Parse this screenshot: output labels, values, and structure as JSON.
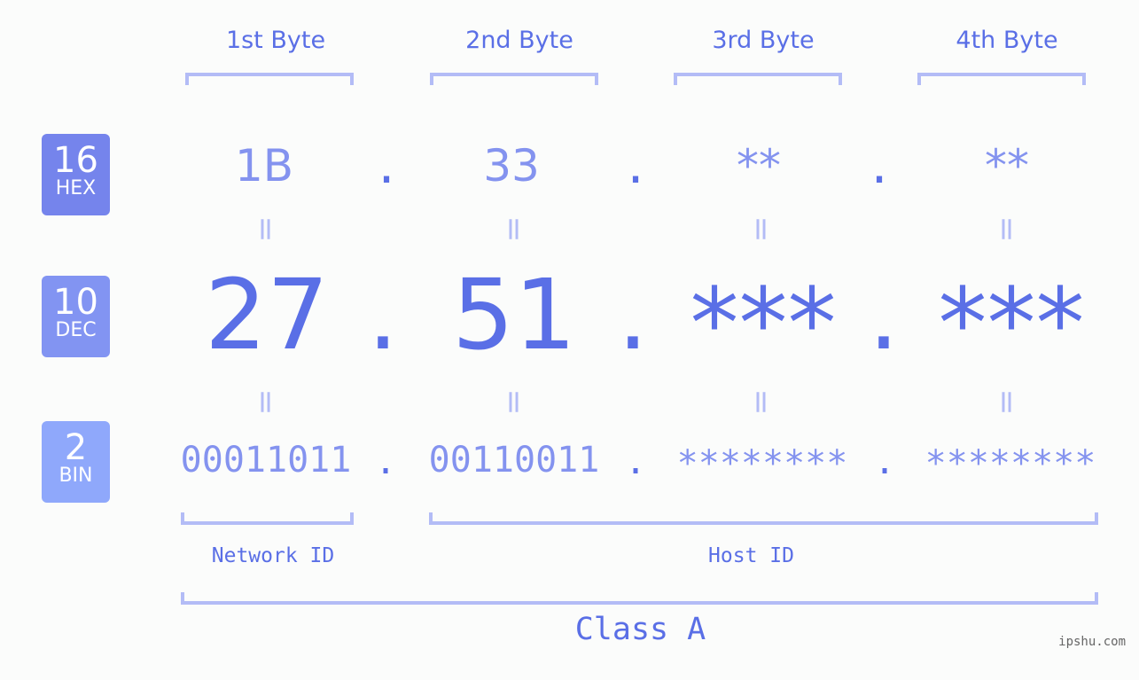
{
  "bytes": [
    {
      "title": "1st Byte",
      "hex": "1B",
      "dec": "27",
      "bin": "00011011"
    },
    {
      "title": "2nd Byte",
      "hex": "33",
      "dec": "51",
      "bin": "00110011"
    },
    {
      "title": "3rd Byte",
      "hex": "**",
      "dec": "***",
      "bin": "********"
    },
    {
      "title": "4th Byte",
      "hex": "**",
      "dec": "***",
      "bin": "********"
    }
  ],
  "separator": ".",
  "equals": "=",
  "badges": {
    "hex": {
      "num": "16",
      "label": "HEX",
      "color": "#7584ec"
    },
    "dec": {
      "num": "10",
      "label": "DEC",
      "color": "#8294f2"
    },
    "bin": {
      "num": "2",
      "label": "BIN",
      "color": "#8fa8fb"
    }
  },
  "parts": {
    "network": "Network ID",
    "host": "Host ID"
  },
  "class_label": "Class A",
  "watermark": "ipshu.com",
  "colors": {
    "primary": "#5a6fe6",
    "secondary": "#8493ef",
    "bracket": "#b3bcf6",
    "background": "#fbfcfb"
  }
}
